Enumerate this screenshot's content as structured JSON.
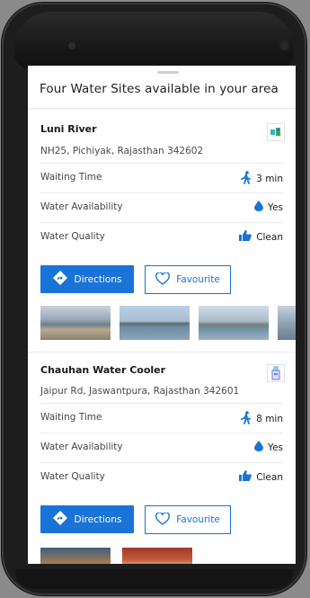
{
  "sheet": {
    "title": "Four Water Sites available in your area"
  },
  "sites": [
    {
      "name": "Luni River",
      "address": "NH25, Pichiyak, Rajasthan 342602",
      "icon": "river-water-icon",
      "rows": [
        {
          "label": "Waiting Time",
          "value": "3 min",
          "icon": "walking-person-icon"
        },
        {
          "label": "Water Availability",
          "value": "Yes",
          "icon": "water-drop-icon"
        },
        {
          "label": "Water Quality",
          "value": "Clean",
          "icon": "thumbs-up-icon"
        }
      ],
      "directions_label": "Directions",
      "favourite_label": "Favourite"
    },
    {
      "name": "Chauhan Water Cooler",
      "address": "Jaipur Rd, Jaswantpura, Rajasthan 342601",
      "icon": "water-cooler-icon",
      "rows": [
        {
          "label": "Waiting Time",
          "value": "8 min",
          "icon": "walking-person-icon"
        },
        {
          "label": "Water Availability",
          "value": "Yes",
          "icon": "water-drop-icon"
        },
        {
          "label": "Water Quality",
          "value": "Clean",
          "icon": "thumbs-up-icon"
        }
      ],
      "directions_label": "Directions",
      "favourite_label": "Favourite"
    }
  ],
  "colors": {
    "accent": "#1a73d6",
    "background": "#ffffff",
    "phone_body": "#1d1d1d"
  }
}
